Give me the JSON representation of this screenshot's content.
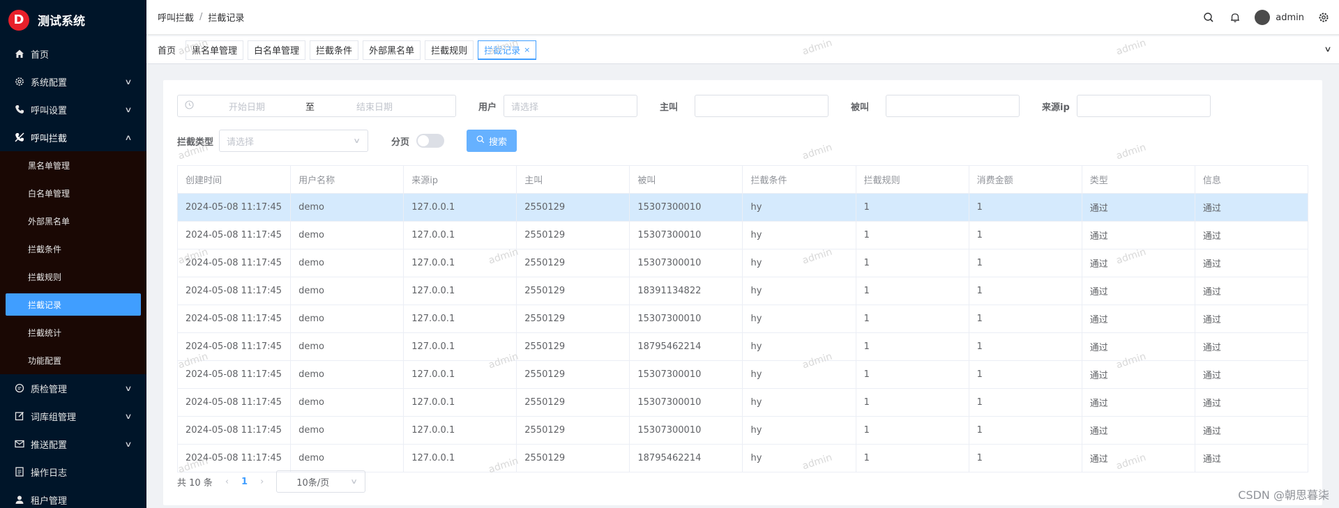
{
  "app": {
    "title": "测试系统",
    "logo_letter": "D"
  },
  "sidebar": {
    "items": [
      {
        "label": "首页",
        "icon": "home-icon"
      },
      {
        "label": "系统配置",
        "icon": "gear-icon"
      },
      {
        "label": "呼叫设置",
        "icon": "phone-icon"
      },
      {
        "label": "呼叫拦截",
        "icon": "phone-block-icon"
      }
    ],
    "sub_items": [
      {
        "label": "黑名单管理"
      },
      {
        "label": "白名单管理"
      },
      {
        "label": "外部黑名单"
      },
      {
        "label": "拦截条件"
      },
      {
        "label": "拦截规则"
      },
      {
        "label": "拦截记录"
      },
      {
        "label": "拦截统计"
      },
      {
        "label": "功能配置"
      }
    ],
    "bottom_items": [
      {
        "label": "质检管理",
        "icon": "chat-icon"
      },
      {
        "label": "词库组管理",
        "icon": "edit-icon"
      },
      {
        "label": "推送配置",
        "icon": "mail-icon"
      },
      {
        "label": "操作日志",
        "icon": "document-icon"
      },
      {
        "label": "租户管理",
        "icon": "user-icon"
      }
    ]
  },
  "header": {
    "breadcrumb": [
      "呼叫拦截",
      "拦截记录"
    ],
    "separator": "/",
    "user": "admin"
  },
  "tags": [
    "首页",
    "黑名单管理",
    "白名单管理",
    "拦截条件",
    "外部黑名单",
    "拦截规则",
    "拦截记录"
  ],
  "tag_close": "×",
  "filters": {
    "start_date_placeholder": "开始日期",
    "to": "至",
    "end_date_placeholder": "结束日期",
    "user_label": "用户",
    "user_placeholder": "请选择",
    "caller_label": "主叫",
    "callee_label": "被叫",
    "source_ip_label": "来源ip",
    "type_label": "拦截类型",
    "type_placeholder": "请选择",
    "page_label": "分页",
    "search_label": "搜索"
  },
  "table": {
    "columns": [
      "创建时间",
      "用户名称",
      "来源ip",
      "主叫",
      "被叫",
      "拦截条件",
      "拦截规则",
      "消费金额",
      "类型",
      "信息"
    ],
    "rows": [
      [
        "2024-05-08 11:17:45",
        "demo",
        "127.0.0.1",
        "2550129",
        "15307300010",
        "hy",
        "1",
        "1",
        "通过",
        "通过"
      ],
      [
        "2024-05-08 11:17:45",
        "demo",
        "127.0.0.1",
        "2550129",
        "15307300010",
        "hy",
        "1",
        "1",
        "通过",
        "通过"
      ],
      [
        "2024-05-08 11:17:45",
        "demo",
        "127.0.0.1",
        "2550129",
        "15307300010",
        "hy",
        "1",
        "1",
        "通过",
        "通过"
      ],
      [
        "2024-05-08 11:17:45",
        "demo",
        "127.0.0.1",
        "2550129",
        "18391134822",
        "hy",
        "1",
        "1",
        "通过",
        "通过"
      ],
      [
        "2024-05-08 11:17:45",
        "demo",
        "127.0.0.1",
        "2550129",
        "15307300010",
        "hy",
        "1",
        "1",
        "通过",
        "通过"
      ],
      [
        "2024-05-08 11:17:45",
        "demo",
        "127.0.0.1",
        "2550129",
        "18795462214",
        "hy",
        "1",
        "1",
        "通过",
        "通过"
      ],
      [
        "2024-05-08 11:17:45",
        "demo",
        "127.0.0.1",
        "2550129",
        "15307300010",
        "hy",
        "1",
        "1",
        "通过",
        "通过"
      ],
      [
        "2024-05-08 11:17:45",
        "demo",
        "127.0.0.1",
        "2550129",
        "15307300010",
        "hy",
        "1",
        "1",
        "通过",
        "通过"
      ],
      [
        "2024-05-08 11:17:45",
        "demo",
        "127.0.0.1",
        "2550129",
        "15307300010",
        "hy",
        "1",
        "1",
        "通过",
        "通过"
      ],
      [
        "2024-05-08 11:17:45",
        "demo",
        "127.0.0.1",
        "2550129",
        "18795462214",
        "hy",
        "1",
        "1",
        "通过",
        "通过"
      ]
    ]
  },
  "pagination": {
    "total": "共 10 条",
    "page": "1",
    "page_size": "10条/页",
    "prev": "‹",
    "next": "›"
  },
  "watermark": "admin",
  "footer_credit": "CSDN @朝思暮柒",
  "colors": {
    "sidebar_bg": "#001529",
    "accent": "#409eff",
    "highlight_row": "#d5eafd",
    "search_button": "#66b1ff"
  }
}
